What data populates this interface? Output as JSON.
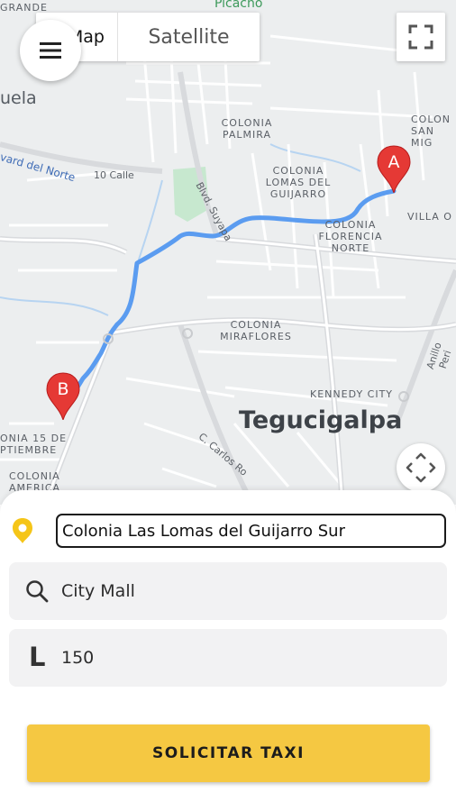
{
  "map": {
    "type_options": {
      "map_label": "Map",
      "satellite_label": "Satellite"
    },
    "labels": {
      "grande": "GRANDE",
      "picacho": "Picacho",
      "venezuela": "uela",
      "col_palmira": "COLONIA\nPALMIRA",
      "col_sanmiguel": "COLON\nSAN MIG",
      "boulevard_norte": "vard del Norte",
      "calle10": "10 Calle",
      "col_lomas": "COLONIA\nLOMAS DEL\nGUIJARRO",
      "blvd_suyapa": "Blvd. Suyapa",
      "col_florencia": "COLONIA\nFLORENCIA\nNORTE",
      "villa_o": "VILLA O",
      "col_miraflores": "COLONIA\nMIRAFLORES",
      "kennedy": "KENNEDY CITY",
      "tegucigalpa": "Tegucigalpa",
      "col_15sept": "ONIA 15 DE\nPTIEMBRE",
      "col_america": "COLONIA\nAMERICA",
      "carlos": "C. Carlos Ro",
      "anillo": "Anillo Peri"
    },
    "markers": {
      "start": "A",
      "end": "B"
    }
  },
  "form": {
    "origin_value": "Colonia Las Lomas del Guijarro Sur",
    "destination_value": "City Mall",
    "quantity_value": "150",
    "quantity_icon": "L",
    "submit_label": "SOLICITAR TAXI"
  },
  "colors": {
    "accent": "#f5c842",
    "route": "#5b9cf0",
    "marker": "#e53935",
    "pin": "#f5c518"
  }
}
